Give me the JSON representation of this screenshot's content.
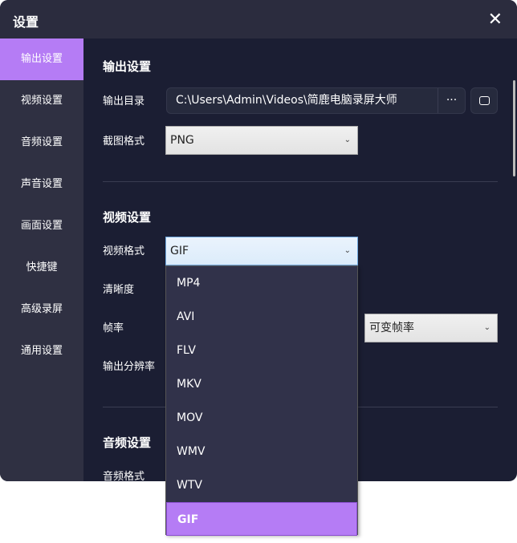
{
  "title": "设置",
  "sidebar": {
    "items": [
      {
        "label": "输出设置"
      },
      {
        "label": "视频设置"
      },
      {
        "label": "音频设置"
      },
      {
        "label": "声音设置"
      },
      {
        "label": "画面设置"
      },
      {
        "label": "快捷键"
      },
      {
        "label": "高级录屏"
      },
      {
        "label": "通用设置"
      }
    ]
  },
  "output": {
    "heading": "输出设置",
    "dir_label": "输出目录",
    "dir_value": "C:\\Users\\Admin\\Videos\\简鹿电脑录屏大师",
    "browse_label": "···",
    "shot_label": "截图格式",
    "shot_value": "PNG"
  },
  "video": {
    "heading": "视频设置",
    "format_label": "视频格式",
    "format_value": "GIF",
    "clarity_label": "清晰度",
    "fps_label": "帧率",
    "fps_value": "可变帧率",
    "res_label": "输出分辨率"
  },
  "audio": {
    "heading": "音频设置",
    "format_label": "音频格式"
  },
  "dropdown": {
    "options": [
      "MP4",
      "AVI",
      "FLV",
      "MKV",
      "MOV",
      "WMV",
      "WTV",
      "GIF"
    ],
    "selected": "GIF"
  },
  "colors": {
    "accent": "#b57cf5",
    "bg": "#1b1e33"
  }
}
